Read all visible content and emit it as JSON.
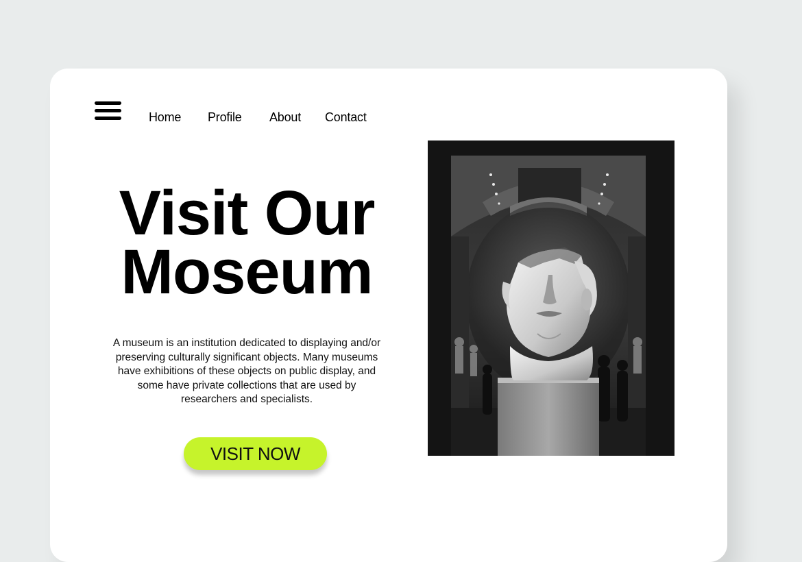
{
  "nav": {
    "items": [
      {
        "label": "Home"
      },
      {
        "label": "Profile"
      },
      {
        "label": "About"
      },
      {
        "label": "Contact"
      }
    ]
  },
  "hero": {
    "title_line1": "Visit Our",
    "title_line2": "Moseum",
    "description": "A museum is an institution dedicated to displaying and/or preserving culturally significant objects. Many museums have exhibitions of these objects on public display, and some have private collections that are used by researchers and specialists.",
    "cta_label": "VISIT NOW"
  },
  "colors": {
    "page_background": "#e9ecec",
    "card_background": "#ffffff",
    "cta_background": "#c6f32b",
    "text": "#000000"
  },
  "icons": {
    "menu": "hamburger-menu-icon"
  },
  "image": {
    "subject": "black-and-white photo of a marble head sculpture on a plinth in a vaulted museum gallery"
  }
}
